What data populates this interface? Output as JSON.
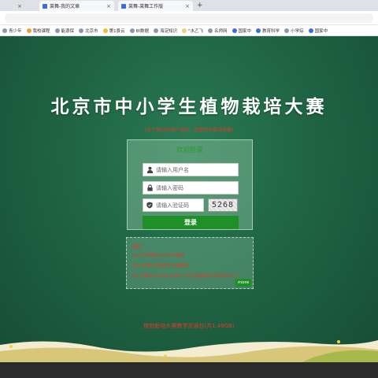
{
  "browser": {
    "tabs": [
      {
        "label": "",
        "close": "×"
      },
      {
        "label": "莱舞-我的文章",
        "close": "×"
      },
      {
        "label": "莱舞-莱舞工作版",
        "close": "×"
      }
    ],
    "new_tab": "+",
    "bookmarks": [
      "青少年",
      "我校课程",
      "能源保",
      "北京市",
      "第1景云",
      "BI数据",
      "海淀知识",
      "\"水乙飞",
      "名师网",
      "国家中",
      "教育科学",
      "小学综",
      "国家中"
    ]
  },
  "page": {
    "title": "北京市中小学生植物栽培大赛",
    "subnote": "(为了更好的用户体验，请使用谷歌浏览器)",
    "login": {
      "heading": "欢迎登录",
      "username_placeholder": "请输入用户名",
      "password_placeholder": "请输入密码",
      "captcha_placeholder": "请输入验证码",
      "captcha_code": "5268",
      "submit_label": "登录"
    },
    "notice": {
      "heading": "通知:",
      "items": [
        "2022北师量2023年冲选假",
        "2023年第5节届北京市选题和",
        "关于开展2023年北京市中小学生植物栽培大赛专业公方"
      ],
      "more_label": "more"
    },
    "download_text": "植物栽培大赛教学资源包(共1.49GB)"
  },
  "colors": {
    "background": "#1f6544",
    "accent_green": "#1f8f27",
    "notice_red": "#e03a2a"
  }
}
